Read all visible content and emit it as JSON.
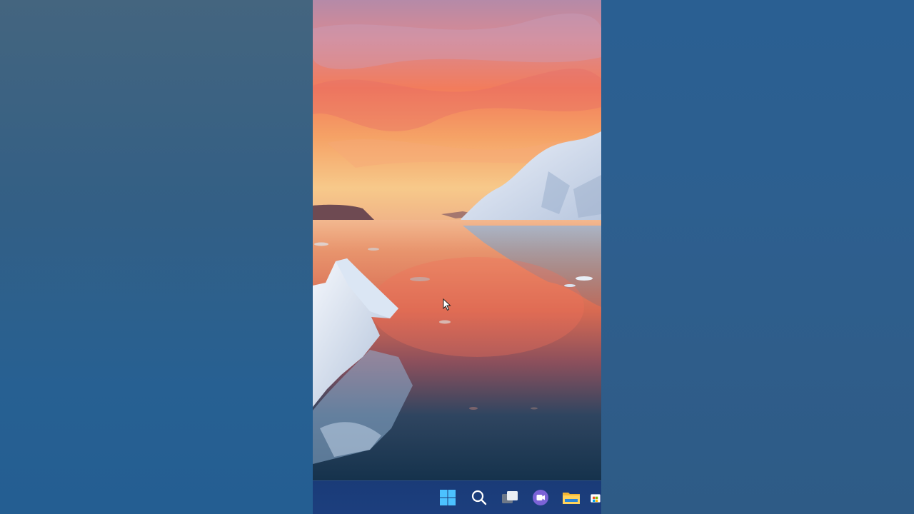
{
  "desktop": {
    "wallpaper": "arctic-sunset-icebergs",
    "colors": {
      "sky_top": "#c98aa6",
      "sky_mid": "#f08a5c",
      "horizon": "#f6c27a",
      "water": "#1c3c5a",
      "ice": "#e6eef8",
      "taskbar": "#1b3d7b"
    }
  },
  "taskbar": {
    "icons": [
      {
        "name": "windows-start-icon"
      },
      {
        "name": "search-icon"
      },
      {
        "name": "task-view-icon"
      },
      {
        "name": "teams-chat-icon"
      },
      {
        "name": "file-explorer-icon"
      },
      {
        "name": "store-icon"
      }
    ]
  }
}
